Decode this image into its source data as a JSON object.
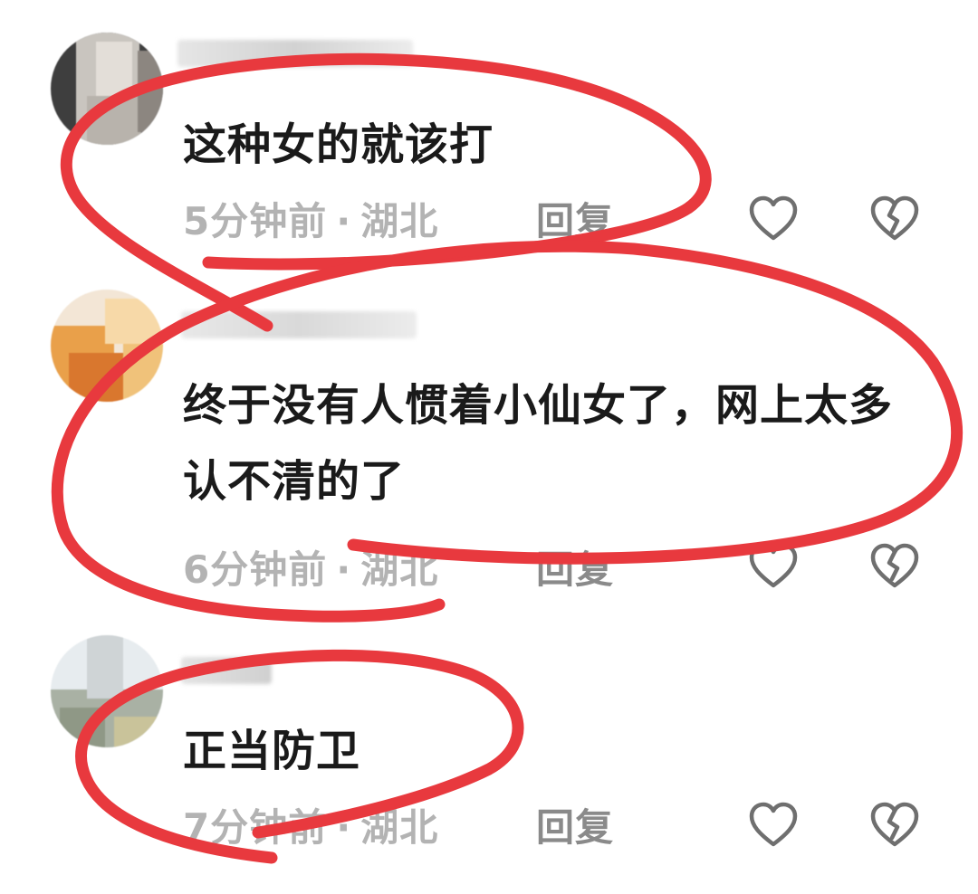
{
  "comments": [
    {
      "text": "这种女的就该打",
      "time": "5分钟前",
      "location": "湖北",
      "reply_label": "回复",
      "username_fragment": "…:"
    },
    {
      "text": "终于没有人惯着小仙女了，网上太多认不清的了",
      "time": "6分钟前",
      "location": "湖北",
      "reply_label": "回复"
    },
    {
      "text": "正当防卫",
      "time": "7分钟前",
      "location": "湖北",
      "reply_label": "回复"
    }
  ],
  "separator": "·",
  "icons": {
    "like": "heart-outline-icon",
    "dislike": "broken-heart-icon"
  },
  "colors": {
    "annotation": "#e8393e",
    "meta_text": "#b3b3b3",
    "reply_text": "#8a8a8a",
    "comment_text": "#1a1a1a",
    "icon_stroke": "#6f6f6f"
  }
}
